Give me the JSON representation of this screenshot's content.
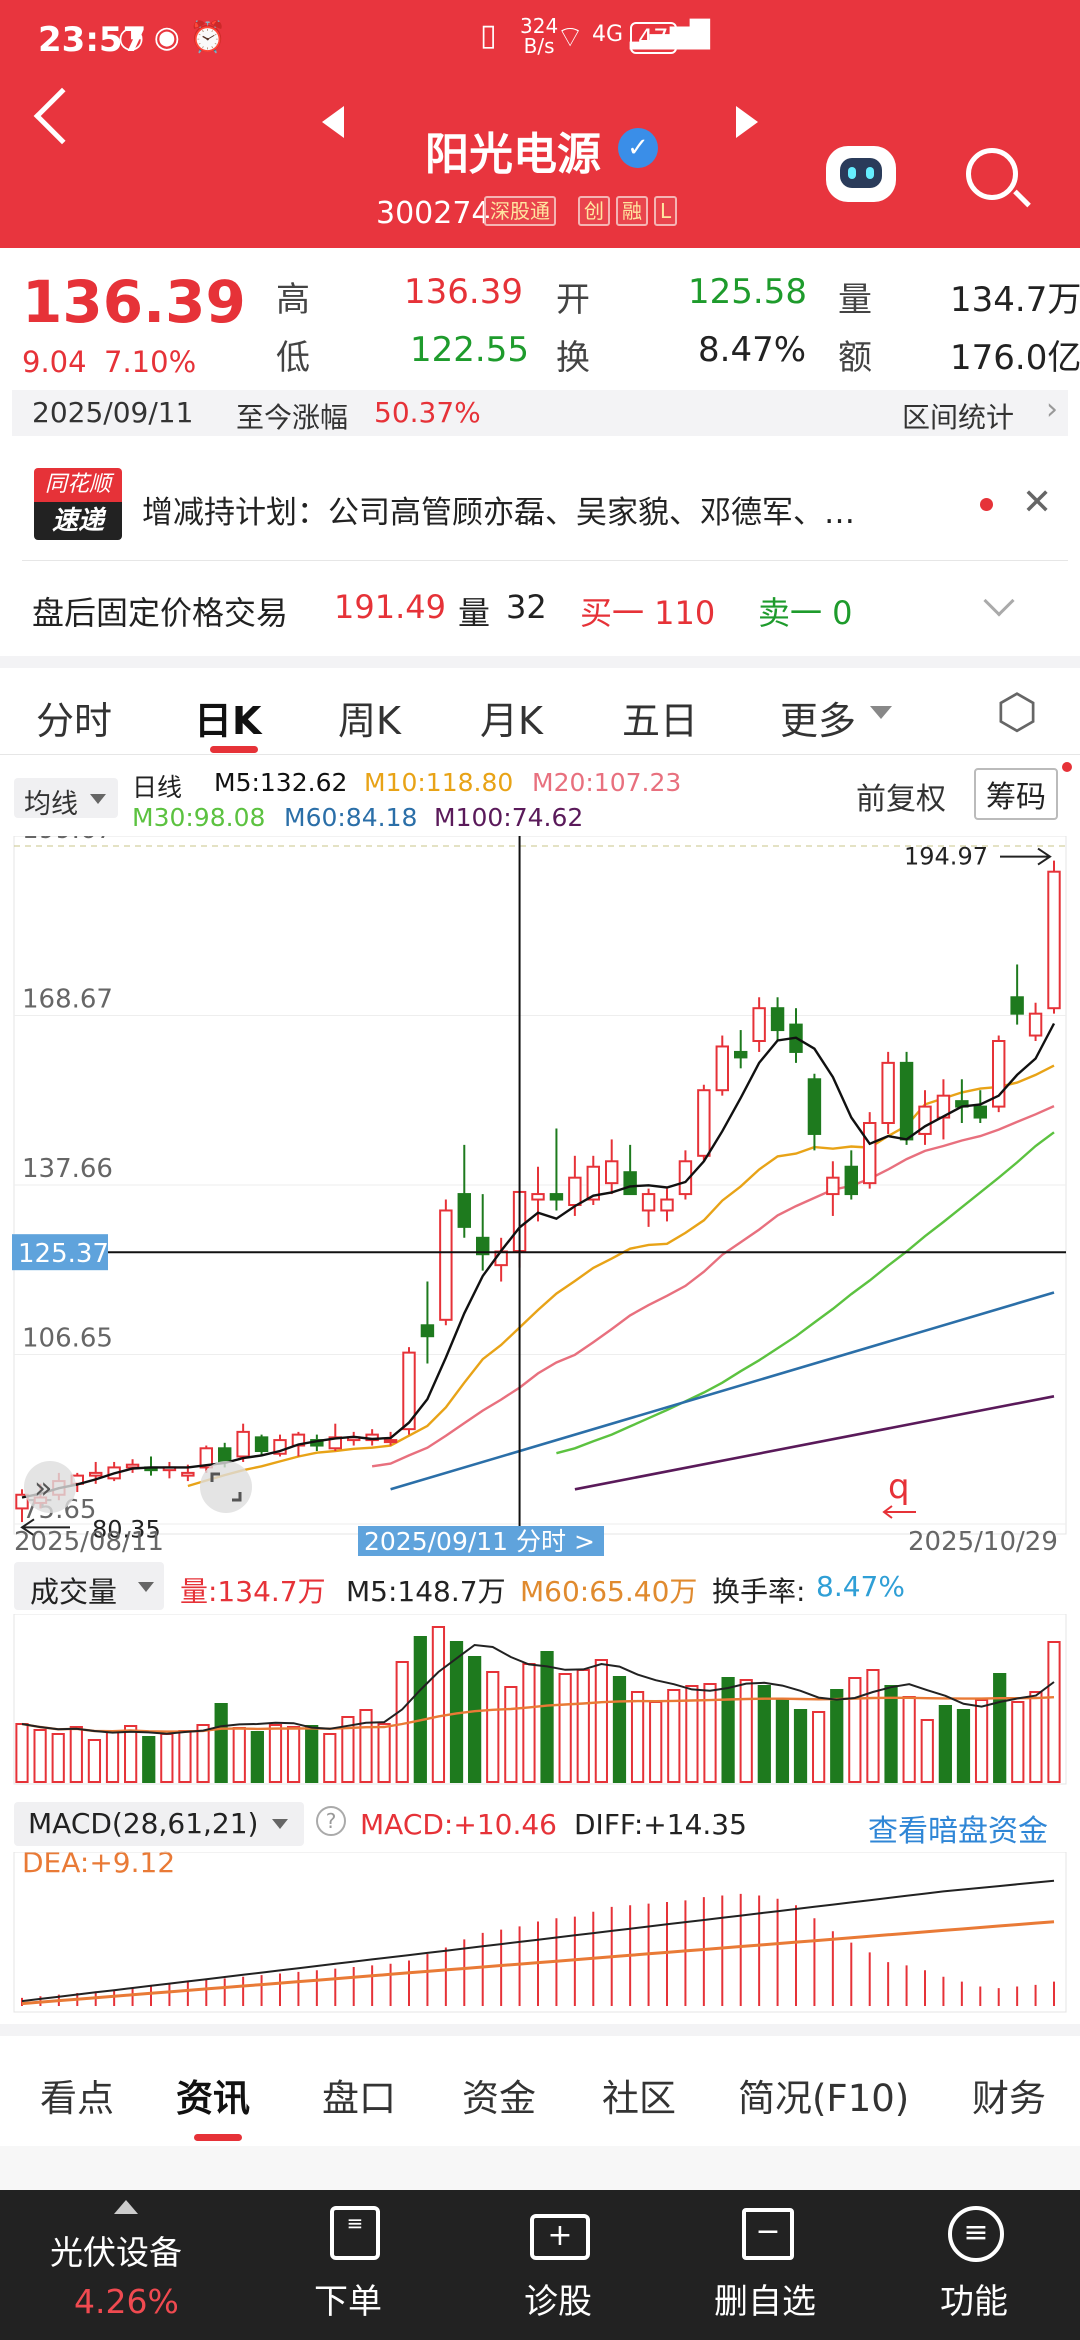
{
  "status": {
    "time": "23:57",
    "speed_top": "324",
    "speed_bottom": "B/s",
    "net": "4G",
    "battery": "47"
  },
  "header": {
    "name": "阳光电源",
    "code": "300274",
    "tags": [
      "深股通",
      "创",
      "融",
      "L"
    ]
  },
  "quote": {
    "price": "136.39",
    "change": "9.04",
    "pct": "7.10%",
    "labels": {
      "high": "高",
      "low": "低",
      "open": "开",
      "turnover": "换",
      "vol": "量",
      "amount": "额"
    },
    "high": "136.39",
    "low": "122.55",
    "open": "125.58",
    "turnover": "8.47%",
    "vol": "134.7万",
    "amount": "176.0亿",
    "date": "2025/09/11",
    "since_label": "至今涨幅",
    "since": "50.37%",
    "interval": "区间统计"
  },
  "news": {
    "logo1": "同花顺",
    "logo2": "速递",
    "text": "增减持计划：公司高管顾亦磊、吴家貌、邓德军、…"
  },
  "after": {
    "label": "盘后固定价格交易",
    "price": "191.49",
    "vol_label": "量",
    "vol": "32",
    "buy": "买一 110",
    "sell": "卖一 0"
  },
  "tabs": [
    "分时",
    "日K",
    "周K",
    "月K",
    "五日",
    "更多"
  ],
  "ma_bar": {
    "selector": "均线",
    "period": "日线",
    "m5": "M5:132.62",
    "m10": "M10:118.80",
    "m20": "M20:107.23",
    "m30": "M30:98.08",
    "m60": "M60:84.18",
    "m100": "M100:74.62",
    "adjust": "前复权",
    "chips": "筹码"
  },
  "colors": {
    "m5": "#111111",
    "m10": "#e8a317",
    "m20": "#e8707e",
    "m30": "#5cc240",
    "m60": "#2b6fa8",
    "m100": "#5a1a5a",
    "up": "#e63238",
    "down": "#1e7a1e"
  },
  "chart_data": [
    {
      "type": "candlestick",
      "y_ticks": [
        "199.67",
        "168.67",
        "137.66",
        "106.65",
        "75.65"
      ],
      "ylim": [
        75.65,
        199.67
      ],
      "crosshair_price": "125.37",
      "max_label": "194.97",
      "min_label": "80.35",
      "x_start": "2025/08/11",
      "x_end": "2025/10/29",
      "x_cross": "2025/09/11  分时 >",
      "candles": [
        {
          "o": 78.5,
          "h": 82.0,
          "l": 76.0,
          "c": 81.0
        },
        {
          "o": 79.5,
          "h": 83.0,
          "l": 78.5,
          "c": 80.5
        },
        {
          "o": 81.0,
          "h": 85.0,
          "l": 80.0,
          "c": 83.5
        },
        {
          "o": 83.0,
          "h": 85.0,
          "l": 81.5,
          "c": 84.5
        },
        {
          "o": 84.5,
          "h": 87.0,
          "l": 83.0,
          "c": 85.0
        },
        {
          "o": 84.0,
          "h": 87.0,
          "l": 83.5,
          "c": 86.0
        },
        {
          "o": 86.0,
          "h": 87.5,
          "l": 85.0,
          "c": 86.5
        },
        {
          "o": 86.0,
          "h": 88.0,
          "l": 84.5,
          "c": 85.5
        },
        {
          "o": 85.5,
          "h": 87.0,
          "l": 84.0,
          "c": 86.0
        },
        {
          "o": 84.5,
          "h": 86.5,
          "l": 83.5,
          "c": 85.0
        },
        {
          "o": 86.0,
          "h": 90.0,
          "l": 85.0,
          "c": 89.5
        },
        {
          "o": 89.5,
          "h": 90.5,
          "l": 86.0,
          "c": 87.0
        },
        {
          "o": 88.0,
          "h": 94.0,
          "l": 87.0,
          "c": 92.5
        },
        {
          "o": 91.5,
          "h": 92.0,
          "l": 88.0,
          "c": 89.0
        },
        {
          "o": 88.5,
          "h": 92.0,
          "l": 88.0,
          "c": 91.0
        },
        {
          "o": 90.0,
          "h": 92.5,
          "l": 88.0,
          "c": 92.0
        },
        {
          "o": 91.0,
          "h": 92.0,
          "l": 89.0,
          "c": 90.0
        },
        {
          "o": 89.5,
          "h": 94.0,
          "l": 89.0,
          "c": 91.5
        },
        {
          "o": 91.0,
          "h": 92.5,
          "l": 90.0,
          "c": 91.5
        },
        {
          "o": 91.0,
          "h": 93.0,
          "l": 90.0,
          "c": 92.0
        },
        {
          "o": 91.0,
          "h": 92.5,
          "l": 90.0,
          "c": 91.0
        },
        {
          "o": 93.0,
          "h": 108.0,
          "l": 92.0,
          "c": 107.0
        },
        {
          "o": 112.0,
          "h": 120.0,
          "l": 105.0,
          "c": 110.0
        },
        {
          "o": 113.0,
          "h": 135.0,
          "l": 112.0,
          "c": 133.0
        },
        {
          "o": 136.0,
          "h": 145.0,
          "l": 128.0,
          "c": 130.0
        },
        {
          "o": 128.0,
          "h": 136.0,
          "l": 122.0,
          "c": 125.0
        },
        {
          "o": 123.0,
          "h": 128.0,
          "l": 120.0,
          "c": 125.5
        },
        {
          "o": 125.58,
          "h": 136.39,
          "l": 122.55,
          "c": 136.39
        },
        {
          "o": 135.0,
          "h": 141.0,
          "l": 131.0,
          "c": 136.0
        },
        {
          "o": 136.0,
          "h": 148.0,
          "l": 133.0,
          "c": 135.0
        },
        {
          "o": 134.0,
          "h": 143.0,
          "l": 132.0,
          "c": 139.0
        },
        {
          "o": 135.0,
          "h": 143.0,
          "l": 134.0,
          "c": 141.0
        },
        {
          "o": 138.0,
          "h": 146.0,
          "l": 136.0,
          "c": 142.0
        },
        {
          "o": 140.0,
          "h": 145.0,
          "l": 136.0,
          "c": 136.0
        },
        {
          "o": 133.0,
          "h": 137.0,
          "l": 130.0,
          "c": 136.0
        },
        {
          "o": 133.0,
          "h": 137.0,
          "l": 131.0,
          "c": 135.0
        },
        {
          "o": 136.0,
          "h": 144.0,
          "l": 135.0,
          "c": 142.0
        },
        {
          "o": 143.0,
          "h": 156.0,
          "l": 142.0,
          "c": 155.0
        },
        {
          "o": 155.0,
          "h": 165.0,
          "l": 154.0,
          "c": 163.0
        },
        {
          "o": 162.0,
          "h": 166.0,
          "l": 159.0,
          "c": 161.0
        },
        {
          "o": 164.0,
          "h": 172.0,
          "l": 162.0,
          "c": 170.0
        },
        {
          "o": 170.0,
          "h": 172.0,
          "l": 164.0,
          "c": 166.0
        },
        {
          "o": 167.0,
          "h": 170.0,
          "l": 160.0,
          "c": 162.0
        },
        {
          "o": 157.0,
          "h": 158.0,
          "l": 144.0,
          "c": 147.0
        },
        {
          "o": 136.0,
          "h": 142.0,
          "l": 132.0,
          "c": 139.0
        },
        {
          "o": 141.0,
          "h": 144.0,
          "l": 135.0,
          "c": 136.0
        },
        {
          "o": 138.0,
          "h": 151.0,
          "l": 137.0,
          "c": 149.0
        },
        {
          "o": 149.0,
          "h": 162.0,
          "l": 147.0,
          "c": 160.0
        },
        {
          "o": 160.0,
          "h": 162.0,
          "l": 145.0,
          "c": 146.0
        },
        {
          "o": 147.0,
          "h": 155.0,
          "l": 145.0,
          "c": 152.0
        },
        {
          "o": 150.0,
          "h": 157.0,
          "l": 146.0,
          "c": 154.0
        },
        {
          "o": 153.0,
          "h": 157.0,
          "l": 149.0,
          "c": 152.0
        },
        {
          "o": 152.0,
          "h": 155.0,
          "l": 149.0,
          "c": 150.0
        },
        {
          "o": 152.0,
          "h": 165.0,
          "l": 151.0,
          "c": 164.0
        },
        {
          "o": 172.0,
          "h": 178.0,
          "l": 167.0,
          "c": 169.0
        },
        {
          "o": 165.0,
          "h": 171.0,
          "l": 164.0,
          "c": 169.0
        },
        {
          "o": 170.0,
          "h": 197.0,
          "l": 169.0,
          "c": 194.97
        }
      ],
      "ma_lines": {
        "m5": [
          80.5,
          81.2,
          82.2,
          82.9,
          83.8,
          84.9,
          85.8,
          86.0,
          86.0,
          86.0,
          86.4,
          86.8,
          87.7,
          88.2,
          89.0,
          90.2,
          90.8,
          91.3,
          91.6,
          91.2,
          91.4,
          94.2,
          98.5,
          106.1,
          114.2,
          121.0,
          125.6,
          129.9,
          132.6,
          131.5,
          133.8,
          135.7,
          136.3,
          137.4,
          137.6,
          137.2,
          138.2,
          142.0,
          147.5,
          153.6,
          160.0,
          164.1,
          164.6,
          162.6,
          157.4,
          150.0,
          145.2,
          146.6,
          146.0,
          148.4,
          150.2,
          152.0,
          152.4,
          154.0,
          157.8,
          160.8,
          167.2
        ],
        "m10": [
          null,
          null,
          null,
          null,
          null,
          null,
          null,
          null,
          null,
          82.6,
          83.6,
          84.6,
          85.5,
          86.2,
          87.1,
          88.0,
          88.7,
          89.0,
          89.4,
          89.6,
          90.0,
          91.8,
          93.6,
          97.0,
          101.5,
          105.8,
          108.4,
          111.6,
          114.8,
          117.8,
          120.1,
          122.5,
          124.2,
          126.0,
          126.7,
          126.9,
          128.9,
          131.2,
          134.8,
          137.4,
          140.5,
          142.9,
          143.4,
          144.6,
          144.3,
          144.7,
          144.5,
          146.6,
          148.5,
          152.4,
          153.5,
          154.6,
          155.3,
          155.6,
          156.4,
          157.8,
          159.5
        ],
        "m20": [
          null,
          null,
          null,
          null,
          null,
          null,
          null,
          null,
          null,
          null,
          null,
          null,
          null,
          null,
          null,
          null,
          null,
          null,
          null,
          86.2,
          86.7,
          88.2,
          89.6,
          91.8,
          94.1,
          96.4,
          98.4,
          100.6,
          103.2,
          105.2,
          106.6,
          108.9,
          111.3,
          113.8,
          115.7,
          117.4,
          119.2,
          121.8,
          124.9,
          127.2,
          129.5,
          132.1,
          133.8,
          135.3,
          136.8,
          137.5,
          138.8,
          140.5,
          142.4,
          143.9,
          144.8,
          145.8,
          146.6,
          147.8,
          149.2,
          150.6,
          152.1
        ],
        "m30": [
          null,
          null,
          null,
          null,
          null,
          null,
          null,
          null,
          null,
          null,
          null,
          null,
          null,
          null,
          null,
          null,
          null,
          null,
          null,
          null,
          null,
          null,
          null,
          null,
          null,
          null,
          null,
          null,
          null,
          88.6,
          89.5,
          90.8,
          92.0,
          93.5,
          95.0,
          96.5,
          98.1,
          99.7,
          101.5,
          103.6,
          105.6,
          107.8,
          110.0,
          112.5,
          115.0,
          117.7,
          120.2,
          122.9,
          125.5,
          128.3,
          130.9,
          133.6,
          136.3,
          139.0,
          141.8,
          144.8,
          147.3
        ],
        "m60": [
          null,
          null,
          null,
          null,
          null,
          null,
          null,
          null,
          null,
          null,
          null,
          null,
          null,
          null,
          null,
          null,
          null,
          null,
          null,
          null,
          null,
          null,
          null,
          null,
          null,
          null,
          null,
          null,
          null,
          null,
          null,
          null,
          null,
          null,
          null,
          null,
          null,
          null,
          null,
          null,
          null,
          null,
          null,
          null,
          null,
          null,
          null,
          null,
          null,
          null,
          null,
          null,
          null,
          null,
          null,
          null,
          null
        ],
        "m60_path": [
          [
            20,
            82.0
          ],
          [
            56,
            118.0
          ]
        ],
        "m100_path": [
          [
            30,
            82.0
          ],
          [
            56,
            99.0
          ]
        ]
      }
    },
    {
      "type": "bar",
      "label": "成交量",
      "vol": "量:134.7万",
      "m5": "M5:148.7万",
      "m60": "M60:65.40万",
      "turnover_label": "换手率:",
      "turnover": "8.47%",
      "values": [
        58,
        52,
        48,
        55,
        42,
        50,
        56,
        45,
        48,
        51,
        57,
        78,
        54,
        50,
        57,
        55,
        56,
        48,
        65,
        72,
        58,
        120,
        145,
        155,
        140,
        125,
        110,
        95,
        118,
        130,
        108,
        112,
        122,
        105,
        90,
        80,
        92,
        96,
        98,
        104,
        102,
        96,
        82,
        72,
        70,
        92,
        104,
        112,
        96,
        85,
        62,
        76,
        72,
        82,
        108,
        80,
        90,
        140
      ]
    },
    {
      "type": "bar",
      "label": "MACD(28,61,21)",
      "macd": "MACD:+10.46",
      "diff": "DIFF:+14.35",
      "dea": "DEA:+9.12",
      "link": "查看暗盘资金",
      "values": [
        1,
        1.2,
        1.4,
        1.6,
        1.8,
        2.0,
        2.2,
        2.4,
        2.7,
        3.0,
        3.2,
        3.4,
        3.6,
        3.8,
        4.0,
        4.2,
        4.4,
        4.6,
        4.8,
        5.0,
        5.2,
        5.6,
        6.4,
        7.2,
        8.2,
        9.0,
        9.4,
        9.8,
        10.4,
        10.8,
        11.0,
        11.6,
        12.2,
        12.4,
        12.6,
        12.8,
        13.0,
        13.4,
        13.6,
        13.8,
        13.6,
        13.2,
        12.4,
        10.8,
        9.2,
        7.8,
        6.6,
        5.4,
        5.0,
        4.4,
        3.6,
        3.0,
        2.4,
        2.2,
        2.4,
        2.6,
        3.0
      ]
    }
  ],
  "bottom_tabs": [
    "看点",
    "资讯",
    "盘口",
    "资金",
    "社区",
    "简况(F10)",
    "财务"
  ],
  "nav": {
    "sector": "光伏设备",
    "sector_pct": "4.26%",
    "items": [
      "下单",
      "诊股",
      "删自选",
      "功能"
    ]
  }
}
